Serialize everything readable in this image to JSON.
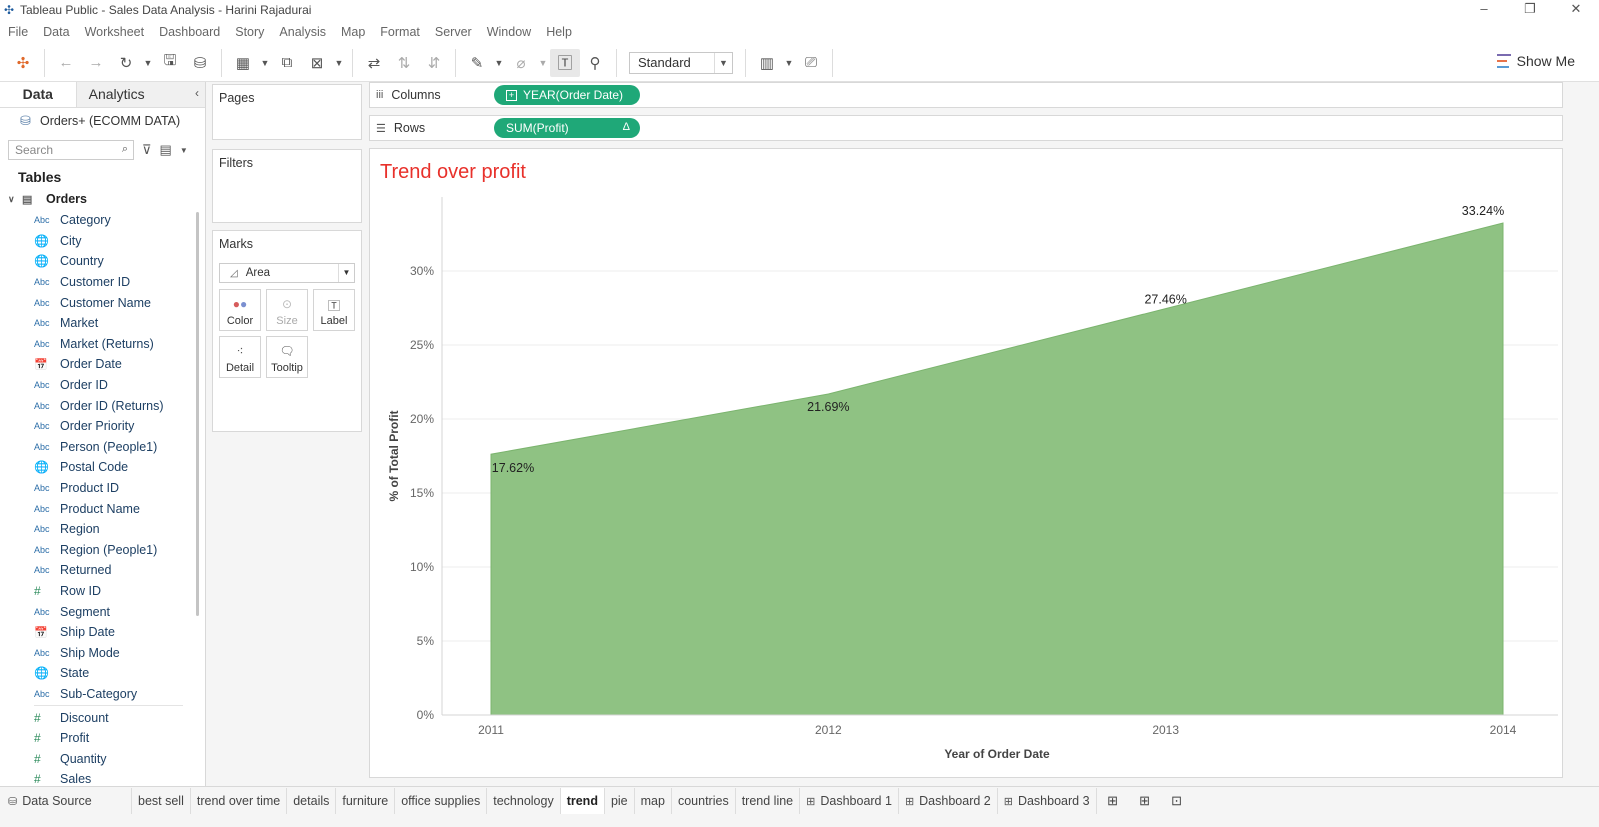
{
  "window": {
    "title": "Tableau Public - Sales Data Analysis - Harini Rajadurai",
    "controls": [
      "–",
      "❐",
      "✕"
    ]
  },
  "menu": [
    "File",
    "Data",
    "Worksheet",
    "Dashboard",
    "Story",
    "Analysis",
    "Map",
    "Format",
    "Server",
    "Window",
    "Help"
  ],
  "toolbar": {
    "fit_select": "Standard",
    "show_me": "Show Me"
  },
  "data_pane": {
    "tab_data": "Data",
    "tab_analytics": "Analytics",
    "source": "Orders+ (ECOMM DATA)",
    "search_placeholder": "Search",
    "tables_heading": "Tables",
    "table_name": "Orders",
    "dimensions": [
      {
        "type": "Abc",
        "name": "Category"
      },
      {
        "type": "geo",
        "name": "City"
      },
      {
        "type": "geo",
        "name": "Country"
      },
      {
        "type": "Abc",
        "name": "Customer ID"
      },
      {
        "type": "Abc",
        "name": "Customer Name"
      },
      {
        "type": "Abc",
        "name": "Market"
      },
      {
        "type": "Abc",
        "name": "Market (Returns)"
      },
      {
        "type": "date",
        "name": "Order Date"
      },
      {
        "type": "Abc",
        "name": "Order ID"
      },
      {
        "type": "Abc",
        "name": "Order ID (Returns)"
      },
      {
        "type": "Abc",
        "name": "Order Priority"
      },
      {
        "type": "Abc",
        "name": "Person (People1)"
      },
      {
        "type": "geo",
        "name": "Postal Code"
      },
      {
        "type": "Abc",
        "name": "Product ID"
      },
      {
        "type": "Abc",
        "name": "Product Name"
      },
      {
        "type": "Abc",
        "name": "Region"
      },
      {
        "type": "Abc",
        "name": "Region (People1)"
      },
      {
        "type": "Abc",
        "name": "Returned"
      },
      {
        "type": "num",
        "name": "Row ID"
      },
      {
        "type": "Abc",
        "name": "Segment"
      },
      {
        "type": "date",
        "name": "Ship Date"
      },
      {
        "type": "Abc",
        "name": "Ship Mode"
      },
      {
        "type": "geo",
        "name": "State"
      },
      {
        "type": "Abc",
        "name": "Sub-Category"
      }
    ],
    "measures": [
      {
        "type": "num",
        "name": "Discount"
      },
      {
        "type": "num",
        "name": "Profit"
      },
      {
        "type": "num",
        "name": "Quantity"
      },
      {
        "type": "num",
        "name": "Sales"
      }
    ]
  },
  "cards": {
    "pages": "Pages",
    "filters": "Filters",
    "marks": "Marks",
    "mark_type": "Area",
    "mark_buttons": [
      {
        "label": "Color",
        "disabled": false
      },
      {
        "label": "Size",
        "disabled": true
      },
      {
        "label": "Label",
        "disabled": false
      },
      {
        "label": "Detail",
        "disabled": false
      },
      {
        "label": "Tooltip",
        "disabled": false
      }
    ]
  },
  "shelves": {
    "columns_label": "Columns",
    "columns_pill": "YEAR(Order Date)",
    "rows_label": "Rows",
    "rows_pill": "SUM(Profit)",
    "rows_pill_badge": "Δ"
  },
  "viz": {
    "title": "Trend over profit",
    "area_color": "#8fc283"
  },
  "chart_data": {
    "type": "area",
    "title": "Trend over profit",
    "xlabel": "Year of Order Date",
    "ylabel": "% of Total Profit",
    "x": [
      "2011",
      "2012",
      "2013",
      "2014"
    ],
    "values": [
      17.62,
      21.69,
      27.46,
      33.24
    ],
    "data_labels": [
      "17.62%",
      "21.69%",
      "27.46%",
      "33.24%"
    ],
    "yticks": [
      "0%",
      "5%",
      "10%",
      "15%",
      "20%",
      "25%",
      "30%"
    ],
    "ylim": [
      0,
      35
    ],
    "grid": true
  },
  "sheet_tabs": [
    {
      "label": "Data Source",
      "kind": "datasource"
    },
    {
      "label": "best sell",
      "kind": "sheet"
    },
    {
      "label": "trend over time",
      "kind": "sheet"
    },
    {
      "label": "details",
      "kind": "sheet"
    },
    {
      "label": "furniture",
      "kind": "sheet"
    },
    {
      "label": "office supplies",
      "kind": "sheet"
    },
    {
      "label": "technology",
      "kind": "sheet"
    },
    {
      "label": "trend",
      "kind": "sheet",
      "active": true
    },
    {
      "label": "pie",
      "kind": "sheet"
    },
    {
      "label": "map",
      "kind": "sheet"
    },
    {
      "label": "countries",
      "kind": "sheet"
    },
    {
      "label": "trend line",
      "kind": "sheet"
    },
    {
      "label": "Dashboard 1",
      "kind": "dashboard"
    },
    {
      "label": "Dashboard 2",
      "kind": "dashboard"
    },
    {
      "label": "Dashboard 3",
      "kind": "dashboard"
    }
  ]
}
